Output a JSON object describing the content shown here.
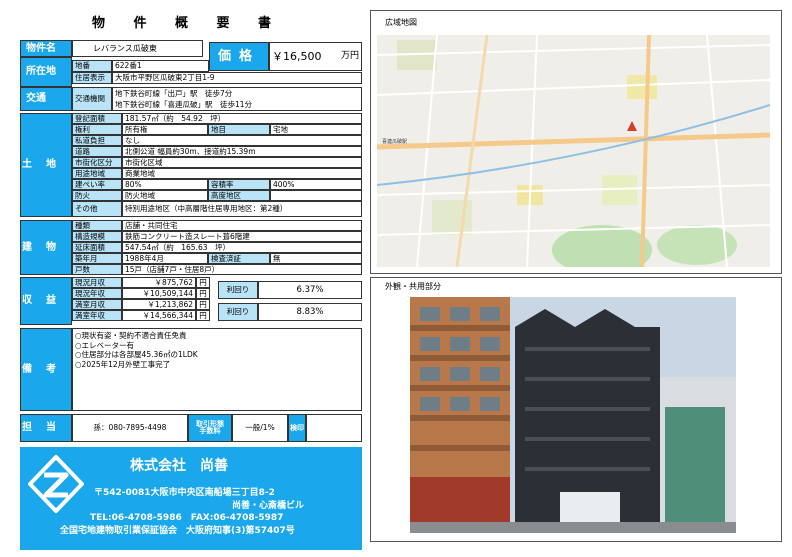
{
  "title": "物 件 概 要 書",
  "property": {
    "name_label": "物件名",
    "name": "レバランス瓜破東",
    "price_label": "価格",
    "price": "￥16,500",
    "price_unit": "万円"
  },
  "location": {
    "label": "所在地",
    "lot_label": "地番",
    "lot": "622番1",
    "addr_label": "住居表示",
    "addr": "大阪市平野区瓜破東2丁目1-9"
  },
  "transport": {
    "label": "交通",
    "sub_label": "交通機関",
    "line1": "地下鉄谷町線「出戸」駅　徒歩7分",
    "line2": "地下鉄谷町線「喜連瓜破」駅　徒歩11分"
  },
  "land": {
    "label": "土地",
    "area_label": "登記面積",
    "area": "181.57㎡（約　54.92　坪）",
    "right_label": "権利",
    "right": "所有権",
    "chimoku_label": "地目",
    "chimoku": "宅地",
    "burden_label": "私道負担",
    "burden": "なし",
    "road_label": "道路",
    "road": "北側公道 幅員約30m、接道約15.39m",
    "city_label": "市街化区分",
    "city": "市街化区域",
    "use_label": "用途地域",
    "use": "商業地域",
    "bcr_label": "建ぺい率",
    "bcr": "80%",
    "far_label": "容積率",
    "far": "400%",
    "fire_label": "防火",
    "fire": "防火地域",
    "height_label": "高度地区",
    "height": "",
    "other_label": "その他",
    "other": "特別用途地区（中高層階住居専用地区：第2種）"
  },
  "building": {
    "label": "建物",
    "type_label": "種類",
    "type": "店舗・共同住宅",
    "struct_label": "構造規模",
    "struct": "鉄筋コンクリート造スレート葺6階建",
    "floor_label": "延床面積",
    "floor": "547.54㎡（約　165.63　坪）",
    "year_label": "築年月",
    "year": "1988年4月",
    "inspect_label": "検査済証",
    "inspect": "無",
    "units_label": "戸数",
    "units": "15戸（店舗7戸・住居8戸）"
  },
  "income": {
    "label": "収益",
    "rows": [
      {
        "label": "現況月収",
        "value": "￥875,762",
        "unit": "円"
      },
      {
        "label": "現況年収",
        "value": "￥10,509,144",
        "unit": "円"
      },
      {
        "label": "満室月収",
        "value": "￥1,213,862",
        "unit": "円"
      },
      {
        "label": "満室年収",
        "value": "￥14,566,344",
        "unit": "円"
      }
    ],
    "yield_label": "利回り",
    "yield1": "6.37%",
    "yield2": "8.83%"
  },
  "notes": {
    "label": "備考",
    "lines": [
      "○現状有姿・契約不適合責任免責",
      "○エレベーター有",
      "○住居部分は各部屋45.36㎡の1LDK",
      "○2025年12月外壁工事完了"
    ]
  },
  "contact": {
    "label": "担当",
    "tel": "孫：080-7895-4498",
    "fee_label": "取引形態 手数料",
    "fee": "一般/1%",
    "check_label": "検印"
  },
  "company": {
    "name": "株式会社　尚善",
    "addr": "〒542-0081大阪市中央区南船場三丁目8-2",
    "bldg": "尚善・心斎橋ビル",
    "tel": "TEL:06-4708-5986　FAX:06-4708-5987",
    "assoc": "全国宅地建物取引業保証協会　大阪府知事(3)第57407号"
  },
  "map": {
    "title": "広域地図",
    "station_label": "喜連瓜破駅"
  },
  "photo_section": {
    "title": "外観・共用部分"
  },
  "colors": {
    "accent": "#1aa7ec",
    "label_bg": "#b9e4f8"
  }
}
